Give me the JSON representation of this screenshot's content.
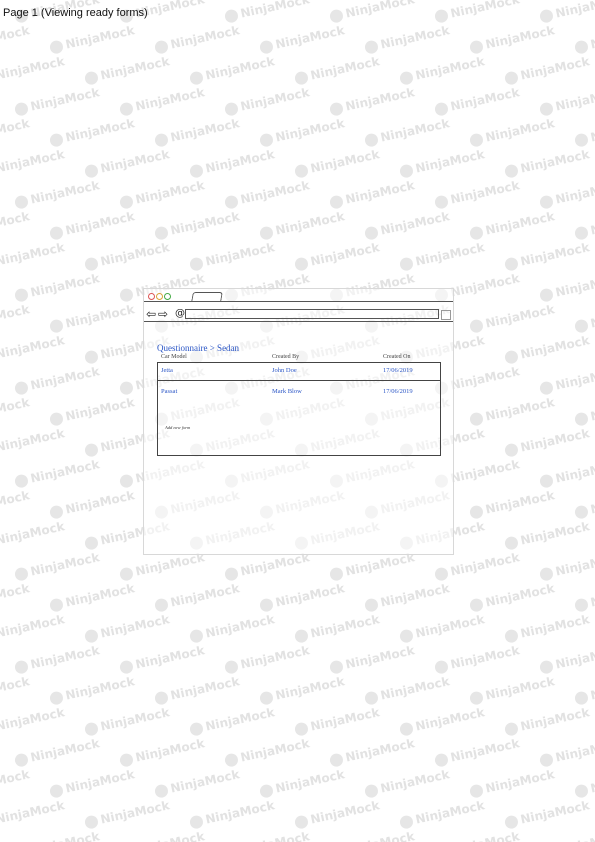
{
  "page": {
    "title": "Page 1 (Viewing ready forms)"
  },
  "watermark": {
    "text": "NinjaMock"
  },
  "browser": {
    "traffic_lights": [
      "red",
      "yellow",
      "green"
    ],
    "nav": {
      "back_icon": "arrow-left-icon",
      "forward_icon": "arrow-right-icon",
      "at_glyph": "@"
    }
  },
  "content": {
    "breadcrumb": "Questionnaire > Sedan",
    "table": {
      "columns": [
        "Car Model",
        "Created By",
        "Created On"
      ],
      "rows": [
        {
          "model": "Jetta",
          "created_by": "John Doe",
          "created_on": "17/06/2019"
        },
        {
          "model": "Passat",
          "created_by": "Mark Blow",
          "created_on": "17/06/2019"
        }
      ],
      "add_link": "Add new form"
    }
  },
  "colors": {
    "link": "#2b56c6",
    "border": "#444444",
    "watermark": "#e2e2e2"
  }
}
